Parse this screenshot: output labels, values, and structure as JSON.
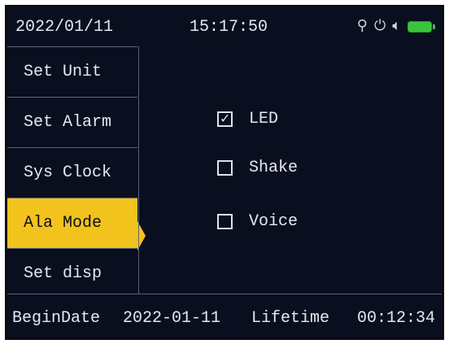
{
  "header": {
    "date": "2022/01/11",
    "time": "15:17:50",
    "icons": [
      "usb-icon",
      "vibrate-icon",
      "speaker-icon",
      "battery-icon"
    ],
    "battery_color": "#38c53b"
  },
  "menu": {
    "items": [
      {
        "label": "Set Unit"
      },
      {
        "label": "Set Alarm"
      },
      {
        "label": "Sys Clock"
      },
      {
        "label": "Ala Mode"
      },
      {
        "label": "Set disp"
      }
    ],
    "selected_label": "Ala Mode",
    "selected_color": "#f2c31c"
  },
  "alarm_mode": {
    "options": [
      {
        "label": "LED",
        "checked": true
      },
      {
        "label": "Shake",
        "checked": false
      },
      {
        "label": "Voice",
        "checked": false
      }
    ]
  },
  "footer": {
    "begin_label": "BeginDate",
    "begin_value": "2022-01-11",
    "life_label": "Lifetime",
    "life_value": "00:12:34"
  }
}
